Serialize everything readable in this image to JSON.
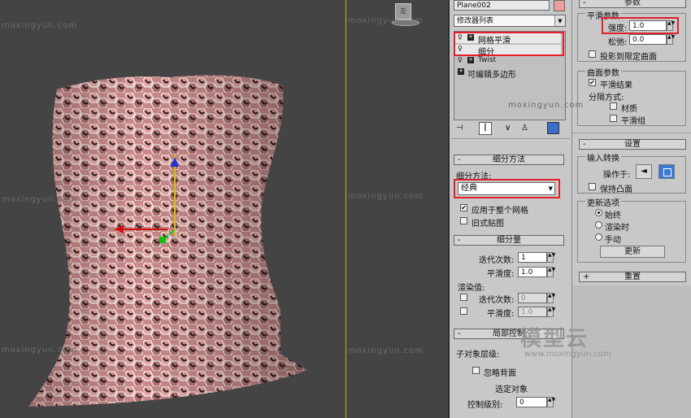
{
  "viewport": {
    "watermarks": [
      "moxingyun.com",
      "moxingyun.com",
      "moxingyun.com",
      "moxingyun.com",
      "moxingyun.com",
      "moxingyun.com",
      "moxingyun.com"
    ],
    "cube_label": "左"
  },
  "modifier": {
    "object_name": "Plane002",
    "list_label": "修改器列表",
    "stack": [
      "网格平滑",
      "细分",
      "Twist",
      "可编辑多边形"
    ]
  },
  "subdiv_method": {
    "title": "细分方法",
    "label": "细分方法:",
    "value": "经典",
    "apply_whole": "应用于整个网格",
    "old_map": "旧式贴图"
  },
  "subdiv_amount": {
    "title": "细分量",
    "iterations_label": "迭代次数:",
    "iterations_value": "1",
    "smoothness_label": "平滑度:",
    "smoothness_value": "1.0",
    "render_label": "渲染值:",
    "r_iterations_label": "迭代次数:",
    "r_iterations_value": "0",
    "r_smoothness_label": "平滑度:",
    "r_smoothness_value": "1.0"
  },
  "local_control": {
    "title": "局部控制",
    "sub_level": "子对象层级:",
    "ignore_back": "忽略背面",
    "selected": "选定对象",
    "control_level": "控制级别:",
    "control_value": "0"
  },
  "params": {
    "title": "参数",
    "smooth_params": "平滑参数",
    "strength_label": "强度:",
    "strength_value": "1.0",
    "relax_label": "松弛:",
    "relax_value": "0.0",
    "project_limit": "投影到限定曲面",
    "surface_params": "曲面参数",
    "smooth_result": "平滑结果",
    "separate_by": "分隔方式:",
    "material": "材质",
    "smooth_groups": "平滑组"
  },
  "settings": {
    "title": "设置",
    "input_conv": "输入转换",
    "operate_on": "操作于:",
    "keep_convex": "保持凸面",
    "update_opts": "更新选项",
    "always": "始终",
    "when_render": "渲染时",
    "manual": "手动",
    "update_btn": "更新"
  },
  "reset": {
    "title": "重置"
  },
  "logo_text": "模型云",
  "logo_url": "www.moxingyun.com"
}
